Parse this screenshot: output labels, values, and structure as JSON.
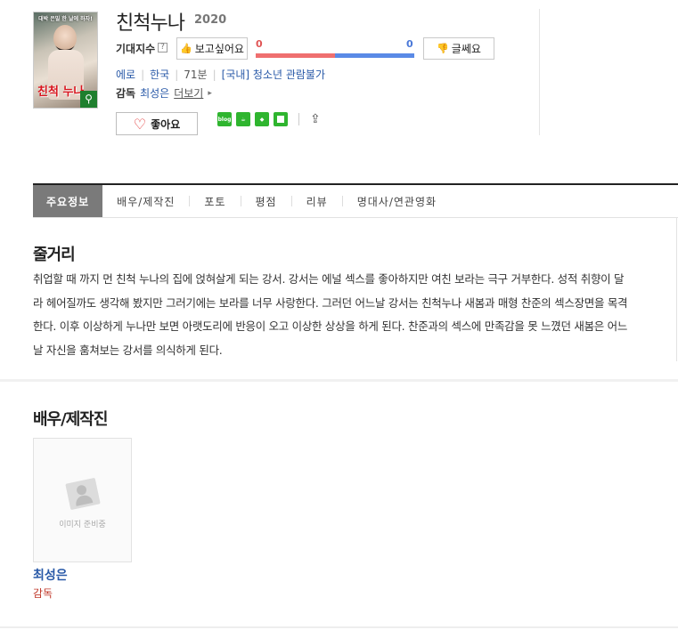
{
  "movie": {
    "title": "친척누나",
    "year": "2020",
    "poster": {
      "top_text": "대박 은밀 한 날에 하자!",
      "title_text": "친척 누나",
      "zoom_icon": "magnifier-icon"
    }
  },
  "expectation": {
    "label": "기대지수",
    "help": "?",
    "want_label": "보고싶어요",
    "want_score": "0",
    "meh_label": "글쎄요",
    "meh_score": "0"
  },
  "meta": {
    "genre": "에로",
    "country": "한국",
    "runtime": "71분",
    "rating": "[국내] 청소년 관람불가"
  },
  "director": {
    "label": "감독",
    "name": "최성은",
    "more": "더보기"
  },
  "like_button": "좋아요",
  "share_icons": [
    "blog-icon",
    "cafe-icon",
    "bookmark-icon",
    "memo-icon",
    "share-icon"
  ],
  "tabs": [
    "주요정보",
    "배우/제작진",
    "포토",
    "평점",
    "리뷰",
    "명대사/연관영화"
  ],
  "synopsis": {
    "title": "줄거리",
    "text": "취업할 때 까지 먼 친척 누나의 집에 얹혀살게 되는 강서. 강서는 에널 섹스를 좋아하지만 여친 보라는 극구 거부한다. 성적 취향이 달라 헤어질까도 생각해 봤지만 그러기에는 보라를 너무 사랑한다. 그러던 어느날 강서는 친척누나 새봄과 매형 찬준의 섹스장면을 목격한다. 이후 이상하게 누나만 보면 아랫도리에 반응이 오고 이상한 상상을 하게 된다. 찬준과의 섹스에 만족감을 못 느꼈던 새봄은 어느날 자신을 훔쳐보는 강서를 의식하게 된다."
  },
  "cast": {
    "title": "배우/제작진",
    "members": [
      {
        "name": "최성은",
        "role": "감독",
        "placeholder": "이미지 준비중"
      }
    ]
  },
  "colors": {
    "link": "#2a5aa8",
    "want": "#ef6f6f",
    "meh": "#5a8ae6",
    "role": "#c0392b"
  }
}
